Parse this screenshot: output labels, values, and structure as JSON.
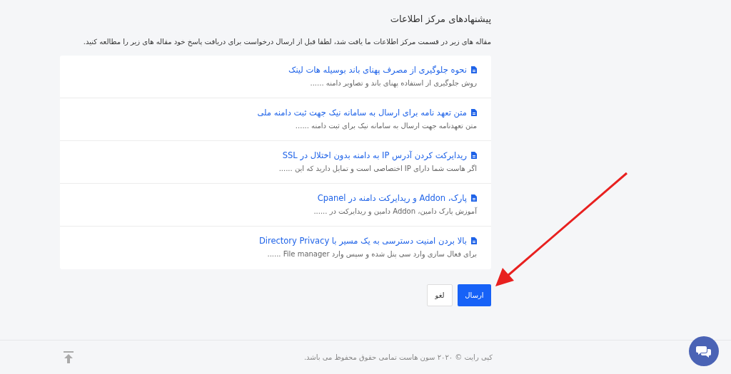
{
  "heading": "پیشنهادهای مرکز اطلاعات",
  "intro": "مقاله های زیر در قسمت مرکز اطلاعات ما یافت شد، لطفا قبل از ارسال درخواست برای دریافت پاسخ خود مقاله های زیر را مطالعه کنید.",
  "articles": [
    {
      "title": "نحوه جلوگیری از مصرف پهنای باند بوسیله هات لینک",
      "summary": "روش جلوگیری از استفاده پهنای باند و تصاویر دامنه ......"
    },
    {
      "title": "متن تعهد نامه برای ارسال به سامانه نیک جهت ثبت دامنه ملی",
      "summary": "متن تعهدنامه جهت ارسال به سامانه نیک برای ثبت دامنه ......"
    },
    {
      "title": "ریدایرکت کردن آدرس IP به دامنه بدون اختلال در SSL",
      "summary": "اگر هاست شما دارای IP اختصاصی است و تمایل دارید که این ......"
    },
    {
      "title": "پارک، Addon و ریدایرکت دامنه در Cpanel",
      "summary": "آموزش پارک دامین، Addon دامین و ریدایرکت در ......"
    },
    {
      "title": "بالا بردن امنیت دسترسی به یک مسیر با Directory Privacy",
      "summary": "برای فعال سازی وارد سی پنل شده و سپس وارد File manager ......"
    }
  ],
  "buttons": [
    {
      "label": "ارسال",
      "kind": "primary"
    },
    {
      "label": "لغو",
      "kind": "secondary"
    }
  ],
  "footer": {
    "copyright": "کپی رایت © ۲۰۲۰ سون هاست تمامی حقوق محفوظ می باشد."
  }
}
